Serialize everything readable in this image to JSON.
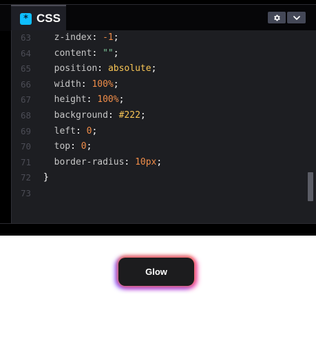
{
  "editor": {
    "tab_icon": "*",
    "tab_title": "CSS",
    "settings_icon": "gear-icon",
    "collapse_icon": "chevron-down-icon"
  },
  "code": {
    "lines": [
      {
        "n": "63",
        "prop": "z-index",
        "sep": ": ",
        "val": "-1",
        "kind": "num",
        "end": ";"
      },
      {
        "n": "64",
        "prop": "content",
        "sep": ": ",
        "val": "\"\"",
        "kind": "str",
        "end": ";"
      },
      {
        "n": "65",
        "prop": "position",
        "sep": ": ",
        "val": "absolute",
        "kind": "kw",
        "end": ";"
      },
      {
        "n": "66",
        "prop": "width",
        "sep": ": ",
        "val": "100%",
        "kind": "num",
        "end": ";"
      },
      {
        "n": "67",
        "prop": "height",
        "sep": ": ",
        "val": "100%",
        "kind": "num",
        "end": ";"
      },
      {
        "n": "68",
        "prop": "background",
        "sep": ": ",
        "val": "#222",
        "kind": "kw",
        "end": ";"
      },
      {
        "n": "69",
        "prop": "left",
        "sep": ": ",
        "val": "0",
        "kind": "num",
        "end": ";"
      },
      {
        "n": "70",
        "prop": "top",
        "sep": ": ",
        "val": "0",
        "kind": "num",
        "end": ";"
      },
      {
        "n": "71",
        "prop": "border-radius",
        "sep": ": ",
        "val": "10px",
        "kind": "num",
        "end": ";"
      },
      {
        "n": "72",
        "prop": "}",
        "sep": "",
        "val": "",
        "kind": "",
        "end": ""
      },
      {
        "n": "73",
        "prop": "",
        "sep": "",
        "val": "",
        "kind": "",
        "end": ""
      }
    ]
  },
  "preview": {
    "button_label": "Glow"
  },
  "colors": {
    "tab_icon_bg": "#0ebeff",
    "editor_bg": "#1d1e22",
    "button_bg": "#1c1c1e"
  }
}
